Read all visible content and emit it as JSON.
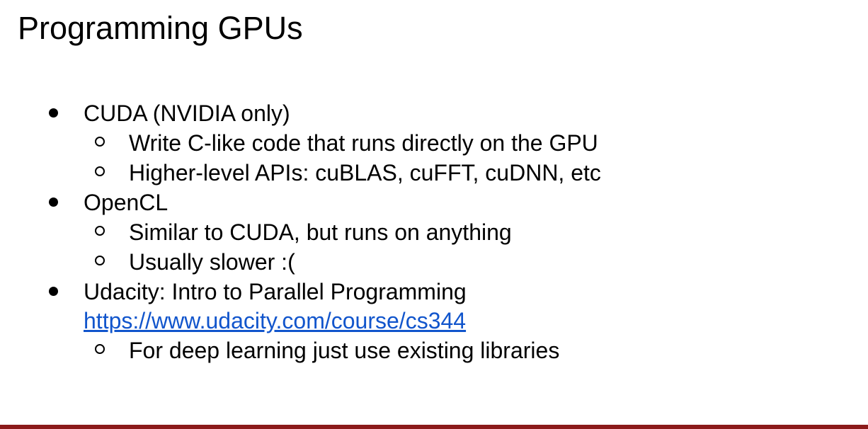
{
  "slide": {
    "title": "Programming GPUs",
    "bullets": [
      {
        "text": "CUDA (NVIDIA only)",
        "sub": [
          "Write C-like code that runs directly on the GPU",
          "Higher-level APIs: cuBLAS, cuFFT, cuDNN, etc"
        ]
      },
      {
        "text": "OpenCL",
        "sub": [
          "Similar to CUDA, but runs on anything",
          "Usually slower :("
        ]
      },
      {
        "text": "Udacity: Intro to Parallel Programming",
        "link": "https://www.udacity.com/course/cs344",
        "sub": [
          "For deep learning just use existing libraries"
        ]
      }
    ]
  },
  "colors": {
    "link": "#1155cc",
    "footer_bar": "#8b1a1a"
  },
  "icons": {
    "level_1_marker": "filled-circle-bullet-icon",
    "level_2_marker": "hollow-circle-bullet-icon"
  }
}
